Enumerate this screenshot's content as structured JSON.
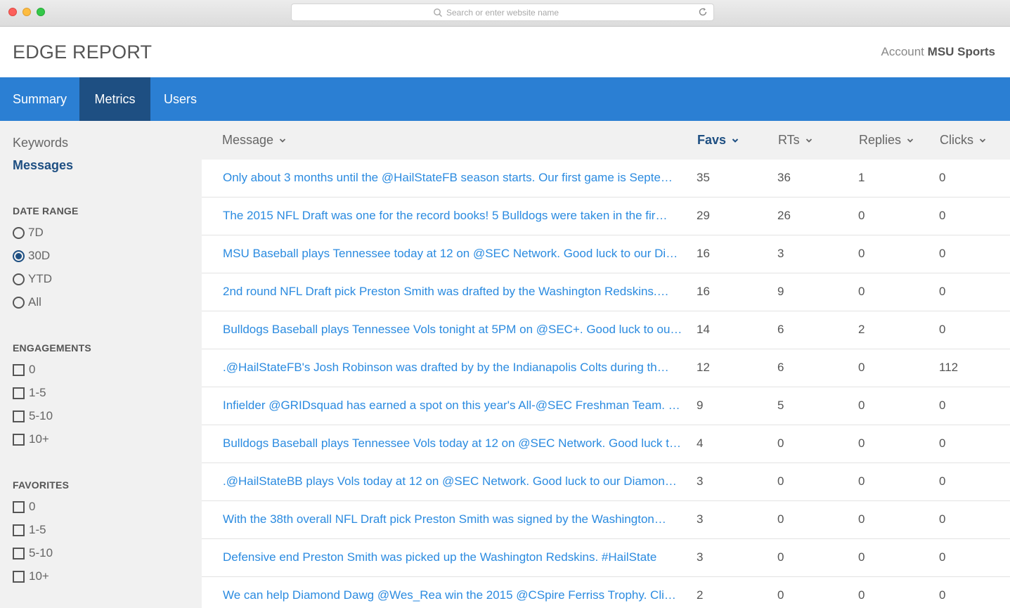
{
  "browser": {
    "url_placeholder": "Search or enter website name"
  },
  "header": {
    "title": "EDGE REPORT",
    "account_label": "Account",
    "account_name": "MSU Sports"
  },
  "nav": {
    "tabs": [
      {
        "label": "Summary",
        "active": false
      },
      {
        "label": "Metrics",
        "active": true
      },
      {
        "label": "Users",
        "active": false
      }
    ]
  },
  "sidebar": {
    "links": [
      {
        "label": "Keywords",
        "active": false
      },
      {
        "label": "Messages",
        "active": true
      }
    ],
    "date_range": {
      "heading": "DATE RANGE",
      "options": [
        {
          "label": "7D",
          "selected": false
        },
        {
          "label": "30D",
          "selected": true
        },
        {
          "label": "YTD",
          "selected": false
        },
        {
          "label": "All",
          "selected": false
        }
      ]
    },
    "engagements": {
      "heading": "ENGAGEMENTS",
      "options": [
        "0",
        "1-5",
        "5-10",
        "10+"
      ]
    },
    "favorites": {
      "heading": "FAVORITES",
      "options": [
        "0",
        "1-5",
        "5-10",
        "10+"
      ]
    }
  },
  "table": {
    "columns": [
      {
        "label": "Message",
        "sorted": false
      },
      {
        "label": "Favs",
        "sorted": true
      },
      {
        "label": "RTs",
        "sorted": false
      },
      {
        "label": "Replies",
        "sorted": false
      },
      {
        "label": "Clicks",
        "sorted": false
      }
    ],
    "rows": [
      {
        "message": "Only about 3 months until the @HailStateFB season starts. Our first game is Septe…",
        "favs": "35",
        "rts": "36",
        "replies": "1",
        "clicks": "0"
      },
      {
        "message": "The 2015 NFL Draft was one for the record books! 5 Bulldogs were taken in the fir…",
        "favs": "29",
        "rts": "26",
        "replies": "0",
        "clicks": "0"
      },
      {
        "message": "MSU Baseball plays Tennessee today at 12 on @SEC Network. Good luck to our Di…",
        "favs": "16",
        "rts": "3",
        "replies": "0",
        "clicks": "0"
      },
      {
        "message": "2nd round NFL Draft pick Preston Smith was drafted by the Washington Redskins.…",
        "favs": "16",
        "rts": "9",
        "replies": "0",
        "clicks": "0"
      },
      {
        "message": "Bulldogs Baseball plays Tennessee Vols tonight at 5PM on @SEC+. Good luck to ou…",
        "favs": "14",
        "rts": "6",
        "replies": "2",
        "clicks": "0"
      },
      {
        "message": ".@HailStateFB's Josh Robinson was drafted by by the Indianapolis Colts during th…",
        "favs": "12",
        "rts": "6",
        "replies": "0",
        "clicks": "112"
      },
      {
        "message": "Infielder @GRIDsquad has earned a spot on this year's All-@SEC Freshman Team. …",
        "favs": "9",
        "rts": "5",
        "replies": "0",
        "clicks": "0"
      },
      {
        "message": "Bulldogs Baseball plays Tennessee Vols today at 12 on @SEC Network. Good luck t…",
        "favs": "4",
        "rts": "0",
        "replies": "0",
        "clicks": "0"
      },
      {
        "message": ".@HailStateBB plays Vols today at 12 on @SEC Network. Good luck to our Diamon…",
        "favs": "3",
        "rts": "0",
        "replies": "0",
        "clicks": "0"
      },
      {
        "message": "With the 38th overall NFL Draft pick Preston Smith was signed by the Washington…",
        "favs": "3",
        "rts": "0",
        "replies": "0",
        "clicks": "0"
      },
      {
        "message": "Defensive end Preston Smith was picked up the Washington Redskins. #HailState",
        "favs": "3",
        "rts": "0",
        "replies": "0",
        "clicks": "0"
      },
      {
        "message": "We can help Diamond Dawg @Wes_Rea win the 2015 @CSpire Ferriss Trophy. Cli…",
        "favs": "2",
        "rts": "0",
        "replies": "0",
        "clicks": "0"
      }
    ]
  },
  "colors": {
    "nav_bg": "#2b7fd3",
    "nav_active": "#1e4f82",
    "link": "#2b8be0",
    "sidebar_bg": "#f1f1f1"
  },
  "icons": {
    "url_search": "search-icon",
    "url_reload": "reload-icon",
    "sort": "chevron-down-icon"
  }
}
